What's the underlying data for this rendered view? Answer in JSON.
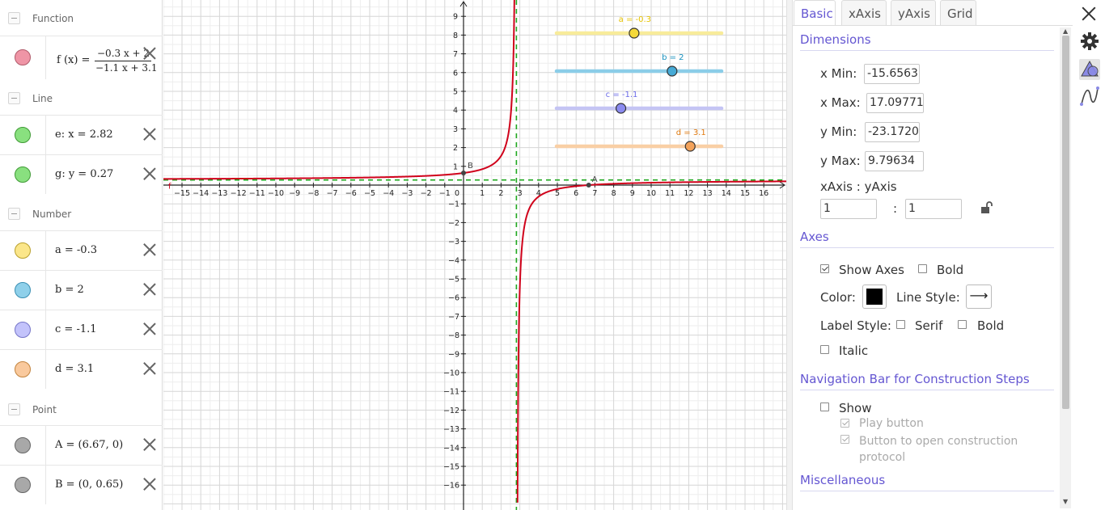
{
  "algebra": {
    "groups": [
      {
        "title": "Function",
        "top": 0
      },
      {
        "title": "Line",
        "top": 100
      },
      {
        "title": "Number",
        "top": 243
      },
      {
        "title": "Point",
        "top": 485
      }
    ],
    "function_item": {
      "lhs": "f (x) =",
      "numerator": "−0.3 x + 2",
      "denominator": "−1.1 x + 3.1",
      "color": "#ef95a6"
    },
    "items": [
      {
        "text": "e: x = 2.82",
        "color": "#89e07f",
        "name": "e"
      },
      {
        "text": "g: y = 0.27",
        "color": "#89e07f",
        "name": "g"
      },
      {
        "text": "a = -0.3",
        "color": "#fbe68a",
        "name": "a"
      },
      {
        "text": "b = 2",
        "color": "#8fd0ea",
        "name": "b"
      },
      {
        "text": "c = -1.1",
        "color": "#c3c3fb",
        "name": "c"
      },
      {
        "text": "d = 3.1",
        "color": "#f9c99d",
        "name": "d"
      },
      {
        "text": "A = (6.67, 0)",
        "color": "#a8a8a8",
        "name": "A"
      },
      {
        "text": "B = (0, 0.65)",
        "color": "#a8a8a8",
        "name": "B"
      }
    ]
  },
  "graphics": {
    "x_ticks": [
      "−15",
      "−14",
      "−13",
      "−12",
      "−11",
      "−10",
      "−9",
      "−8",
      "−7",
      "−6",
      "−5",
      "−4",
      "−3",
      "−2",
      "−1",
      "0",
      "1",
      "2",
      "3",
      "4",
      "5",
      "6",
      "7",
      "8",
      "9",
      "10",
      "11",
      "12",
      "13",
      "14",
      "15",
      "16"
    ],
    "y_ticks_pos": [
      "1",
      "2",
      "3",
      "4",
      "5",
      "6",
      "7",
      "8",
      "9"
    ],
    "y_ticks_neg": [
      "−1",
      "−2",
      "−3",
      "−4",
      "−5",
      "−6",
      "−7",
      "−8",
      "−9",
      "−10",
      "−11",
      "−12",
      "−13",
      "−14",
      "−15",
      "−16"
    ],
    "function_label": "f",
    "point_A_label": "A",
    "point_B_label": "B",
    "sliders": [
      {
        "label": "a = -0.3",
        "color": "#e7c300",
        "track": "#f8ec9a",
        "fill": "#f5d93a",
        "value": -0.3,
        "min": -5,
        "max": 5
      },
      {
        "label": "b = 2",
        "color": "#1891bf",
        "track": "#8bcde8",
        "fill": "#46aad6",
        "value": 2,
        "min": -5,
        "max": 5
      },
      {
        "label": "c = -1.1",
        "color": "#6b6be8",
        "track": "#c4c4f4",
        "fill": "#8b8bf0",
        "value": -1.1,
        "min": -5,
        "max": 5
      },
      {
        "label": "d = 3.1",
        "color": "#e07a10",
        "track": "#f9cfa5",
        "fill": "#f3a25a",
        "value": 3.1,
        "min": -5,
        "max": 5
      }
    ],
    "colors": {
      "function": "#d0021b",
      "asymptote": "#1fa81f",
      "axes": "#222",
      "grid_major": "#d6d6d6",
      "grid_minor": "#eeeeee"
    }
  },
  "props": {
    "tabs": [
      "Basic",
      "xAxis",
      "yAxis",
      "Grid"
    ],
    "active_tab": "Basic",
    "sections": {
      "dimensions": "Dimensions",
      "axes": "Axes",
      "nav": "Navigation Bar for Construction Steps",
      "misc": "Miscellaneous"
    },
    "dims": {
      "xmin_label": "x Min:",
      "xmin": "-15.6563",
      "xmax_label": "x Max:",
      "xmax": "17.09771",
      "ymin_label": "y Min:",
      "ymin": "-23.1720",
      "ymax_label": "y Max:",
      "ymax": "9.79634",
      "ratio_label": "xAxis : yAxis",
      "ratio_x": "1",
      "ratio_sep": ":",
      "ratio_y": "1"
    },
    "axes": {
      "show_axes": "Show Axes",
      "bold": "Bold",
      "color_label": "Color:",
      "line_style_label": "Line Style:",
      "line_style_glyph": "⟶",
      "label_style": "Label Style:",
      "serif": "Serif",
      "bold2": "Bold",
      "italic": "Italic",
      "color_value": "#000000"
    },
    "nav": {
      "show": "Show",
      "play": "Play button",
      "open_protocol": "Button to open construction protocol"
    }
  }
}
